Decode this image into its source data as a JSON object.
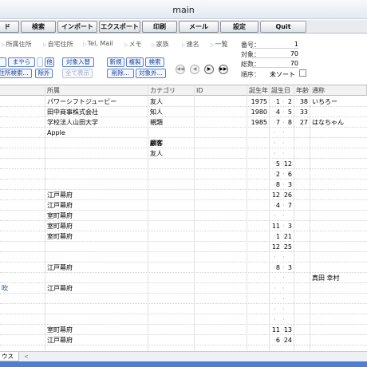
{
  "window": {
    "title": "main"
  },
  "toolbar": {
    "buttons": [
      {
        "label": "ド"
      },
      {
        "label": "検索"
      },
      {
        "label": "インポート"
      },
      {
        "label": "エクスポート"
      },
      {
        "label": "印刷"
      },
      {
        "label": "メール"
      },
      {
        "label": "設定"
      },
      {
        "label": "Quit"
      }
    ]
  },
  "panel": {
    "crumbs": [
      "所属住所",
      "自宅住所",
      "Tel, Mail",
      "メモ",
      "家族",
      "連名",
      "一覧"
    ],
    "small_buttons": [
      "まやら",
      "他",
      "対象入替",
      "新規",
      "複製",
      "検索",
      "住所検索...",
      "除外",
      "全て表示",
      "削除...",
      "対象外..."
    ],
    "nav_icons": [
      "first-icon",
      "prev-icon",
      "next-icon",
      "last-icon"
    ],
    "nav_glyphs": [
      "◀◀",
      "◀",
      "▶",
      "▶▶"
    ],
    "stats": [
      {
        "label": "番号：",
        "value": "1"
      },
      {
        "label": "対象：",
        "value": "70"
      },
      {
        "label": "総数：",
        "value": "70"
      }
    ],
    "sort_label": "順序：",
    "sort_value": "未ソート"
  },
  "table": {
    "headers": [
      "所属",
      "カテゴリ",
      "ID",
      "誕生年",
      "誕生日",
      "年齢",
      "通称"
    ],
    "rows": [
      {
        "name": "",
        "org": "パワーシフトジュービー",
        "cat": "友人",
        "year": "1975",
        "m": "1",
        "d": "2",
        "age": "38",
        "nick": "いちろー",
        "bold": false
      },
      {
        "name": "",
        "org": "田中商事株式会社",
        "cat": "知人",
        "year": "1980",
        "m": "4",
        "d": "5",
        "age": "33",
        "nick": "",
        "bold": false
      },
      {
        "name": "",
        "org": "学校法人山田大学",
        "cat": "親類",
        "year": "1985",
        "m": "7",
        "d": "8",
        "age": "27",
        "nick": "はなちゃん",
        "bold": false
      },
      {
        "name": "",
        "org": "Apple",
        "cat": "",
        "year": "",
        "m": "",
        "d": "",
        "age": "",
        "nick": "",
        "bold": false
      },
      {
        "name": "",
        "org": "",
        "cat": "顧客",
        "year": "",
        "m": "",
        "d": "",
        "age": "",
        "nick": "",
        "bold": true
      },
      {
        "name": "",
        "org": "",
        "cat": "友人",
        "year": "",
        "m": "",
        "d": "",
        "age": "",
        "nick": "",
        "bold": false
      },
      {
        "name": "",
        "org": "",
        "cat": "",
        "year": "",
        "m": "5",
        "d": "12",
        "age": "",
        "nick": "",
        "bold": false
      },
      {
        "name": "",
        "org": "",
        "cat": "",
        "year": "",
        "m": "2",
        "d": "6",
        "age": "",
        "nick": "",
        "bold": false
      },
      {
        "name": "",
        "org": "",
        "cat": "",
        "year": "",
        "m": "8",
        "d": "3",
        "age": "",
        "nick": "",
        "bold": false
      },
      {
        "name": "",
        "org": "江戸幕府",
        "cat": "",
        "year": "",
        "m": "12",
        "d": "26",
        "age": "",
        "nick": "",
        "bold": false
      },
      {
        "name": "",
        "org": "江戸幕府",
        "cat": "",
        "year": "",
        "m": "4",
        "d": "7",
        "age": "",
        "nick": "",
        "bold": false
      },
      {
        "name": "",
        "org": "室町幕府",
        "cat": "",
        "year": "",
        "m": "",
        "d": "",
        "age": "",
        "nick": "",
        "bold": false
      },
      {
        "name": "",
        "org": "室町幕府",
        "cat": "",
        "year": "",
        "m": "11",
        "d": "3",
        "age": "",
        "nick": "",
        "bold": false
      },
      {
        "name": "",
        "org": "室町幕府",
        "cat": "",
        "year": "",
        "m": "1",
        "d": "21",
        "age": "",
        "nick": "",
        "bold": false
      },
      {
        "name": "",
        "org": "",
        "cat": "",
        "year": "",
        "m": "12",
        "d": "25",
        "age": "",
        "nick": "",
        "bold": false
      },
      {
        "name": "",
        "org": "",
        "cat": "",
        "year": "",
        "m": "",
        "d": "",
        "age": "",
        "nick": "",
        "bold": false
      },
      {
        "name": "",
        "org": "江戸幕府",
        "cat": "",
        "year": "",
        "m": "8",
        "d": "3",
        "age": "",
        "nick": "",
        "bold": false
      },
      {
        "name": "",
        "org": "",
        "cat": "",
        "year": "",
        "m": "",
        "d": "",
        "age": "",
        "nick": "真田 幸村",
        "bold": false
      },
      {
        "name": "吹",
        "org": "江戸幕府",
        "cat": "",
        "year": "",
        "m": "",
        "d": "",
        "age": "",
        "nick": "",
        "bold": false
      },
      {
        "name": "",
        "org": "",
        "cat": "",
        "year": "",
        "m": "",
        "d": "",
        "age": "",
        "nick": "",
        "bold": false
      },
      {
        "name": "",
        "org": "",
        "cat": "",
        "year": "",
        "m": "",
        "d": "",
        "age": "",
        "nick": "",
        "bold": false
      },
      {
        "name": "",
        "org": "",
        "cat": "",
        "year": "",
        "m": "",
        "d": "",
        "age": "",
        "nick": "",
        "bold": false
      },
      {
        "name": "",
        "org": "室町幕府",
        "cat": "",
        "year": "",
        "m": "11",
        "d": "13",
        "age": "",
        "nick": "",
        "bold": false
      },
      {
        "name": "",
        "org": "江戸幕府",
        "cat": "",
        "year": "",
        "m": "6",
        "d": "24",
        "age": "",
        "nick": "",
        "bold": false
      }
    ]
  },
  "footer": {
    "tab_label": "ウス",
    "scroll_glyph": "<"
  },
  "colors": {
    "link_blue": "#1a3f9a",
    "footer_bar": "#4a7fd4"
  }
}
